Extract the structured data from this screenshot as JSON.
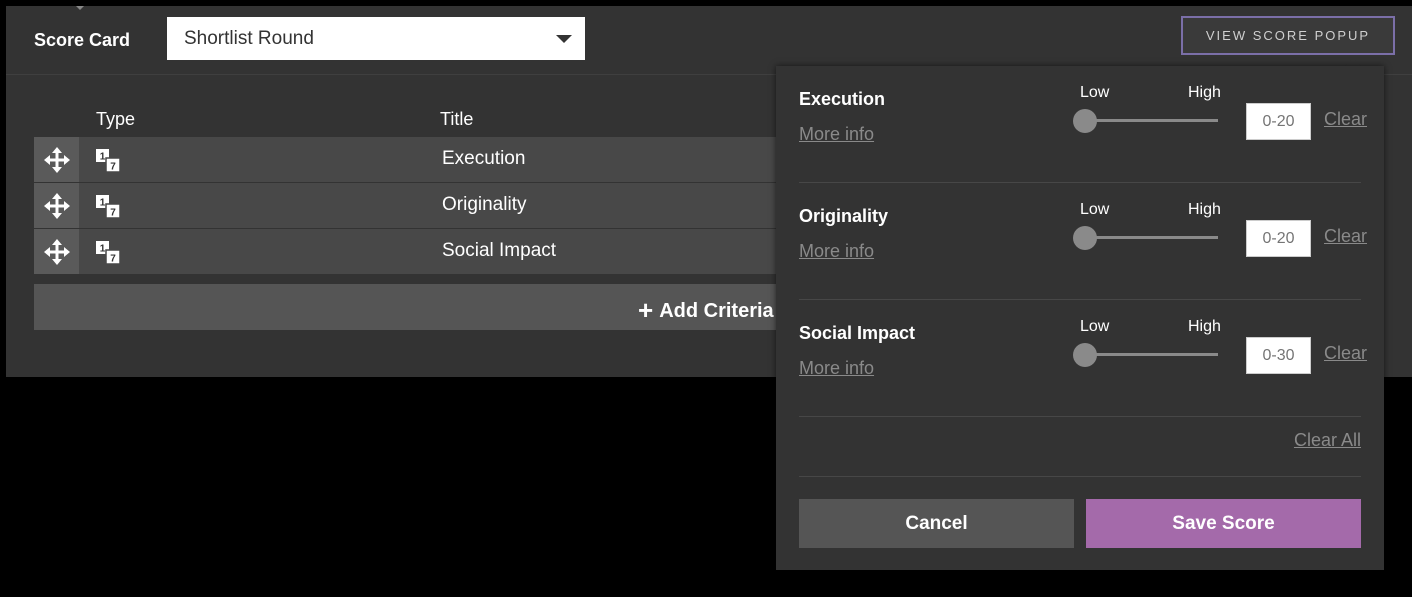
{
  "header": {
    "scorecard_label": "Score Card",
    "scorecard_value": "Shortlist Round",
    "view_popup_label": "VIEW SCORE POPUP"
  },
  "table": {
    "columns": [
      "Type",
      "Title"
    ],
    "rows": [
      {
        "type_icon": "numeric-scale-icon",
        "title": "Execution"
      },
      {
        "type_icon": "numeric-scale-icon",
        "title": "Originality"
      },
      {
        "type_icon": "numeric-scale-icon",
        "title": "Social Impact"
      }
    ],
    "type_icon_digits": {
      "top": "1",
      "bottom": "7"
    },
    "add_criteria_label": "Add Criteria"
  },
  "popup": {
    "criteria": [
      {
        "name": "Execution",
        "more_info": "More info",
        "low": "Low",
        "high": "High",
        "slider_value": 0,
        "placeholder": "0-20",
        "clear": "Clear"
      },
      {
        "name": "Originality",
        "more_info": "More info",
        "low": "Low",
        "high": "High",
        "slider_value": 0,
        "placeholder": "0-20",
        "clear": "Clear"
      },
      {
        "name": "Social Impact",
        "more_info": "More info",
        "low": "Low",
        "high": "High",
        "slider_value": 0,
        "placeholder": "0-30",
        "clear": "Clear"
      }
    ],
    "clear_all": "Clear All",
    "cancel": "Cancel",
    "save": "Save Score"
  },
  "colors": {
    "panel_bg": "#333333",
    "save_accent": "#a46aaa",
    "popup_button_border": "#7b6fa8"
  }
}
